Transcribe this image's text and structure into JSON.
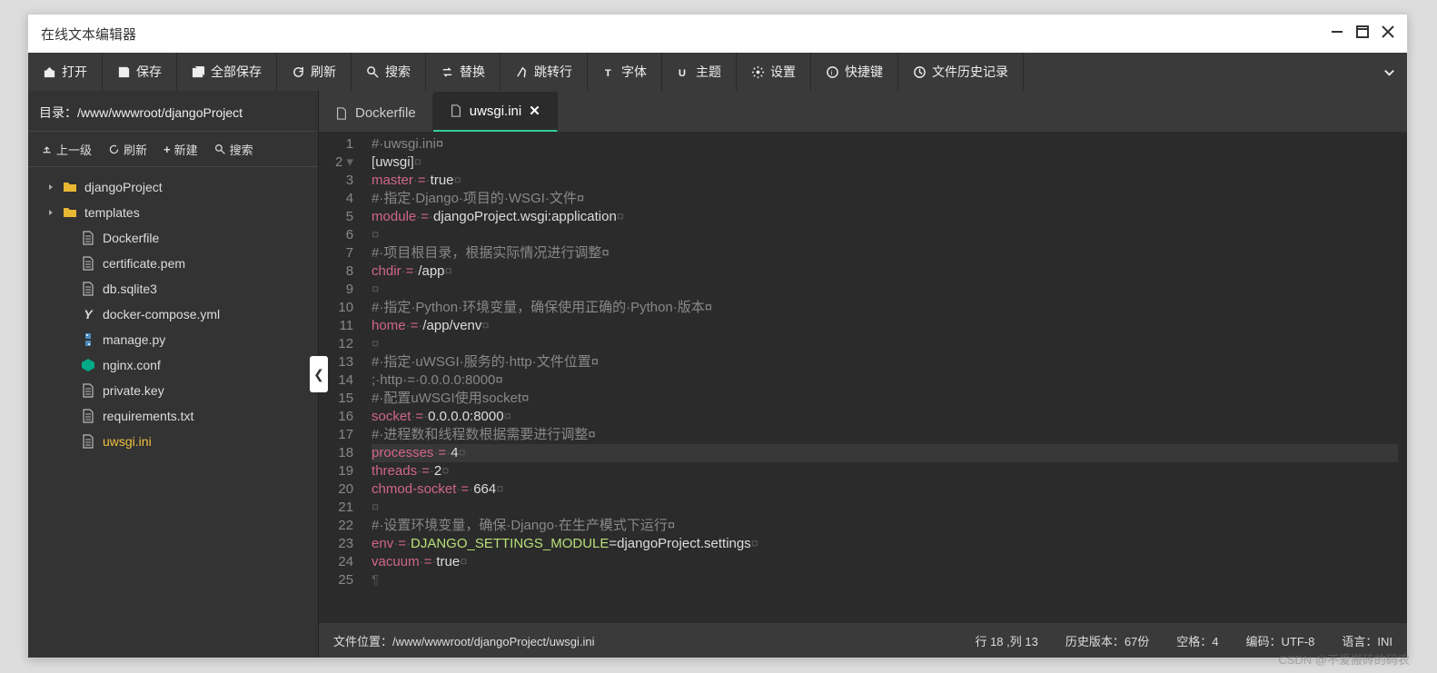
{
  "window": {
    "title": "在线文本编辑器"
  },
  "toolbar": {
    "open": "打开",
    "save": "保存",
    "save_all": "全部保存",
    "refresh": "刷新",
    "search": "搜索",
    "replace": "替换",
    "goto": "跳转行",
    "font": "字体",
    "theme": "主题",
    "settings": "设置",
    "shortcuts": "快捷键",
    "history": "文件历史记录"
  },
  "sidebar": {
    "dir_label": "目录：",
    "dir_path": "/www/wwwroot/djangoProject",
    "up": "上一级",
    "refresh": "刷新",
    "new": "新建",
    "search": "搜索",
    "items": [
      {
        "name": "djangoProject",
        "type": "folder",
        "expandable": true
      },
      {
        "name": "templates",
        "type": "folder",
        "expandable": true
      },
      {
        "name": "Dockerfile",
        "type": "file"
      },
      {
        "name": "certificate.pem",
        "type": "file"
      },
      {
        "name": "db.sqlite3",
        "type": "file"
      },
      {
        "name": "docker-compose.yml",
        "type": "yml"
      },
      {
        "name": "manage.py",
        "type": "py"
      },
      {
        "name": "nginx.conf",
        "type": "nginx"
      },
      {
        "name": "private.key",
        "type": "file"
      },
      {
        "name": "requirements.txt",
        "type": "file"
      },
      {
        "name": "uwsgi.ini",
        "type": "file",
        "active": true
      }
    ]
  },
  "tabs": [
    {
      "label": "Dockerfile",
      "active": false
    },
    {
      "label": "uwsgi.ini",
      "active": true,
      "close": "✕"
    }
  ],
  "code": {
    "total_lines": 25,
    "current_line": 18,
    "lines": [
      {
        "n": 1,
        "t": "comment",
        "text": "#·uwsgi.ini¤"
      },
      {
        "n": 2,
        "raw": "<span class='c-punct'>[</span><span class='c-val'>uwsgi</span><span class='c-punct'>]</span><span class='invis'>¤</span>",
        "fold": true
      },
      {
        "n": 3,
        "raw": "<span class='c-key'>master</span><span class='invis'>·</span><span class='c-op'>=</span><span class='invis'>·</span><span class='c-val'>true</span><span class='invis'>¤</span>"
      },
      {
        "n": 4,
        "t": "comment",
        "text": "#·指定·Django·项目的·WSGI·文件¤"
      },
      {
        "n": 5,
        "raw": "<span class='c-key'>module</span><span class='invis'>·</span><span class='c-op'>=</span><span class='invis'>·</span><span class='c-val'>djangoProject.wsgi:application</span><span class='invis'>¤</span>"
      },
      {
        "n": 6,
        "t": "blank"
      },
      {
        "n": 7,
        "t": "comment",
        "text": "#·项目根目录，根据实际情况进行调整¤"
      },
      {
        "n": 8,
        "raw": "<span class='c-key'>chdir</span><span class='invis'>·</span><span class='c-op'>=</span><span class='invis'>·</span><span class='c-val'>/app</span><span class='invis'>¤</span>"
      },
      {
        "n": 9,
        "t": "blank"
      },
      {
        "n": 10,
        "t": "comment",
        "text": "#·指定·Python·环境变量，确保使用正确的·Python·版本¤"
      },
      {
        "n": 11,
        "raw": "<span class='c-key'>home</span><span class='invis'>·</span><span class='c-op'>=</span><span class='invis'>·</span><span class='c-val'>/app/venv</span><span class='invis'>¤</span>"
      },
      {
        "n": 12,
        "t": "blank"
      },
      {
        "n": 13,
        "t": "comment",
        "text": "#·指定·uWSGI·服务的·http·文件位置¤"
      },
      {
        "n": 14,
        "t": "comment",
        "text": ";·http·=·0.0.0.0:8000¤"
      },
      {
        "n": 15,
        "t": "comment",
        "text": "#·配置uWSGI使用socket¤"
      },
      {
        "n": 16,
        "raw": "<span class='c-key'>socket</span><span class='invis'>·</span><span class='c-op'>=</span><span class='invis'>·</span><span class='c-val'>0.0.0.0:8000</span><span class='invis'>¤</span>"
      },
      {
        "n": 17,
        "t": "comment",
        "text": "#·进程数和线程数根据需要进行调整¤"
      },
      {
        "n": 18,
        "raw": "<span class='c-key'>processes</span><span class='invis'>·</span><span class='c-op'>=</span><span class='invis'>·</span><span class='c-val'>4</span><span class='invis'>¤</span>",
        "current": true
      },
      {
        "n": 19,
        "raw": "<span class='c-key'>threads</span><span class='invis'>·</span><span class='c-op'>=</span><span class='invis'>·</span><span class='c-val'>2</span><span class='invis'>¤</span>"
      },
      {
        "n": 20,
        "raw": "<span class='c-key'>chmod-socket</span><span class='invis'>·</span><span class='c-op'>=</span><span class='invis'>·</span><span class='c-val'>664</span><span class='invis'>¤</span>"
      },
      {
        "n": 21,
        "t": "blank"
      },
      {
        "n": 22,
        "t": "comment",
        "text": "#·设置环境变量，确保·Django·在生产模式下运行¤"
      },
      {
        "n": 23,
        "raw": "<span class='c-key'>env</span><span class='invis'>·</span><span class='c-op'>=</span><span class='invis'>·</span><span class='c-string'>DJANGO_SETTINGS_MODULE</span><span class='c-val'>=djangoProject.settings</span><span class='invis'>¤</span>"
      },
      {
        "n": 24,
        "raw": "<span class='c-key'>vacuum</span><span class='invis'>·</span><span class='c-op'>=</span><span class='invis'>·</span><span class='c-val'>true</span><span class='invis'>¤</span>"
      },
      {
        "n": 25,
        "t": "eof"
      }
    ]
  },
  "statusbar": {
    "path_label": "文件位置：",
    "path": "/www/wwwroot/djangoProject/uwsgi.ini",
    "cursor": "行 18 ,列 13",
    "history": "历史版本：67份",
    "spaces": "空格：4",
    "encoding": "编码：UTF-8",
    "lang": "语言：INI"
  },
  "watermark": "CSDN @不爱搬砖的码农"
}
